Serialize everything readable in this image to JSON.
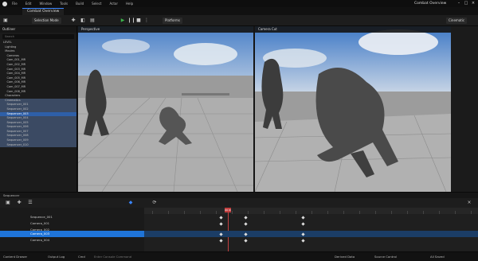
{
  "menu": {
    "items": [
      "File",
      "Edit",
      "Window",
      "Tools",
      "Build",
      "Select",
      "Actor",
      "Help"
    ],
    "document": "Combat Overview"
  },
  "tabs": {
    "level": "Combat Overview"
  },
  "toolbar": {
    "mode": "Selection Mode",
    "platforms": "Platforms",
    "viewport_label": "Cinematic"
  },
  "outliner": {
    "title": "Outliner",
    "search_placeholder": "Search",
    "items": [
      "LEVEL",
      "  Lighting",
      "  Movies",
      "    Cameras",
      "    Cam_001_MR",
      "    Cam_002_MR",
      "    Cam_003_MR",
      "    Cam_004_MR",
      "    Cam_005_MR",
      "    Cam_006_MR",
      "    Cam_007_MR",
      "    Cam_008_MR",
      "  Characters",
      "  Cinematics",
      "    Sequencer_001",
      "    Sequencer_002",
      "    Sequencer_003",
      "    Sequencer_004",
      "    Sequencer_005",
      "    Sequencer_006",
      "    Sequencer_007",
      "    Sequencer_008",
      "    Sequencer_009",
      "    Sequencer_010"
    ]
  },
  "viewports": {
    "left": "Perspective",
    "right": "Camera Cut"
  },
  "sequencer": {
    "title": "Sequencer",
    "tracks": [
      "Sequence_001",
      "Camera_001",
      "Camera_002",
      "Camera_003",
      "Camera_004"
    ],
    "playhead": "0000"
  },
  "status": {
    "content_drawer": "Content Drawer",
    "output_log": "Output Log",
    "cmd": "Cmd",
    "console_placeholder": "Enter Console Command",
    "derived": "Derived Data",
    "source": "Source Control",
    "all_saved": "All Saved"
  }
}
